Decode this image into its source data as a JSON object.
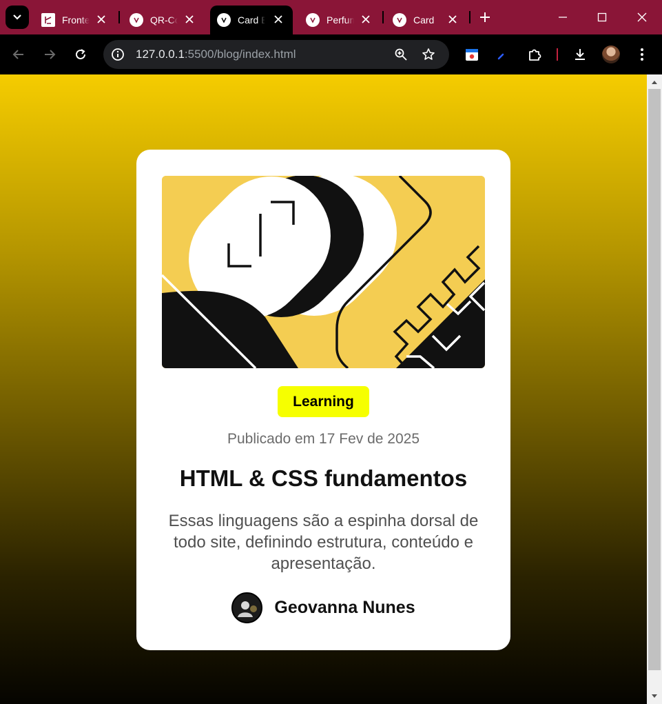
{
  "browser": {
    "tabs": [
      {
        "title": "Frontend",
        "favicon": "frontend-mentor-icon",
        "active": false
      },
      {
        "title": "QR-Code",
        "favicon": "vscode-live-icon",
        "active": false
      },
      {
        "title": "Card Blog",
        "favicon": "vscode-live-icon",
        "active": true
      },
      {
        "title": "Perfume",
        "favicon": "vscode-live-icon",
        "active": false
      },
      {
        "title": "Card",
        "favicon": "vscode-live-icon",
        "active": false
      }
    ],
    "url_host": "127.0.0.1",
    "url_rest": ":5500/blog/index.html",
    "colors": {
      "tabstrip": "#8a1537",
      "toolbar": "#000000"
    }
  },
  "card": {
    "badge": "Learning",
    "published": "Publicado em 17 Fev de 2025",
    "title": "HTML & CSS fundamentos",
    "description": "Essas linguagens são a espinha dorsal de todo site, definindo estrutura, conteúdo e apresentação.",
    "author": "Geovanna Nunes",
    "colors": {
      "badge": "#f6ff00",
      "illustration": "#f4cd52",
      "background_top": "#f5cc00",
      "background_bottom": "#000000"
    }
  }
}
